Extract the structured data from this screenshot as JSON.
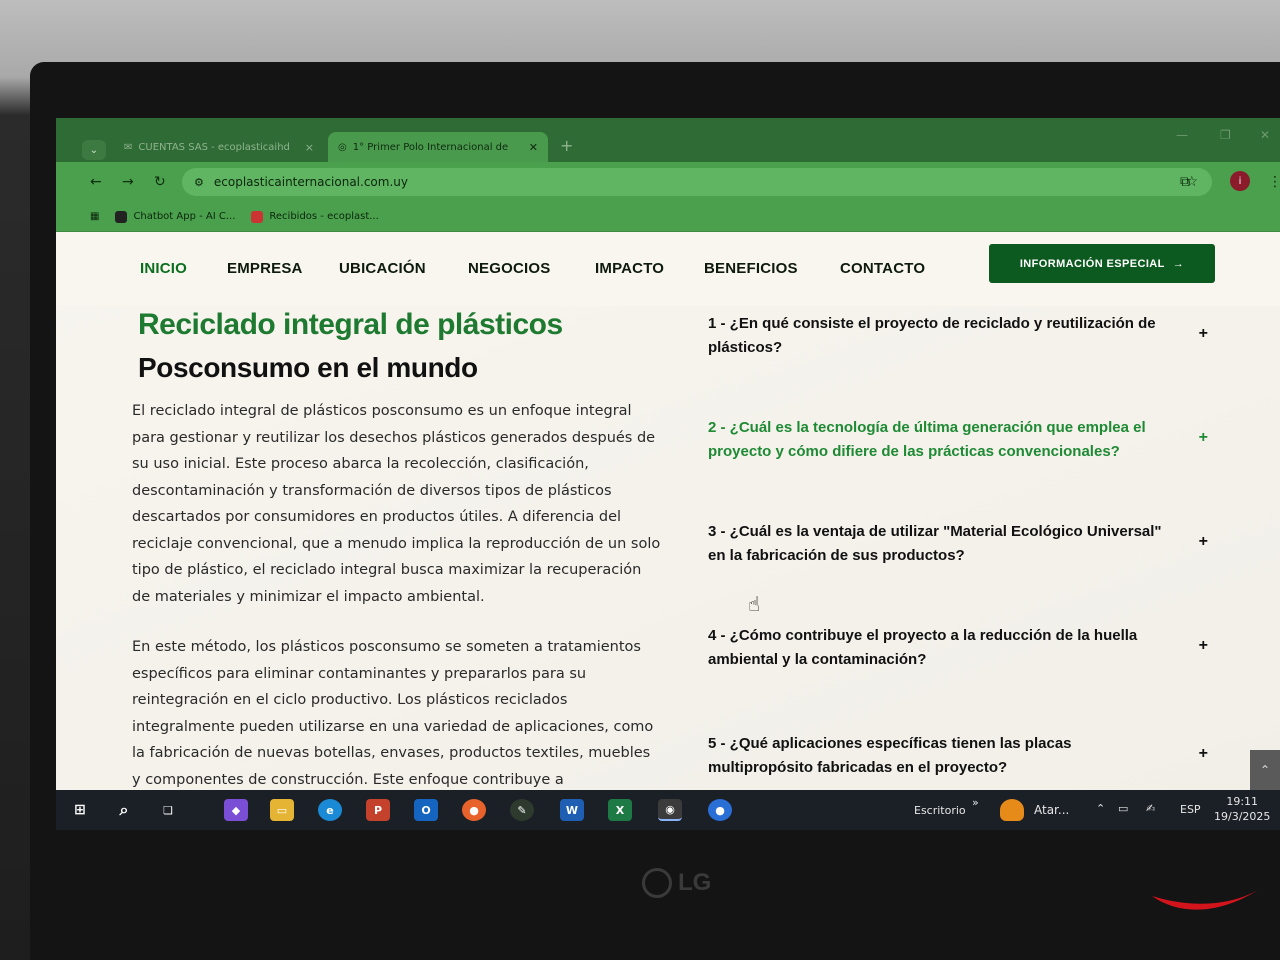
{
  "browser": {
    "tabs": [
      {
        "label": "CUENTAS SAS - ecoplasticaihd",
        "state": "inactive"
      },
      {
        "label": "1° Primer Polo Internacional de",
        "state": "active"
      }
    ],
    "new_tab": "+",
    "url": "ecoplasticainternacional.com.uy",
    "bookmarks": [
      {
        "label": "Chatbot App - AI C..."
      },
      {
        "label": "Recibidos - ecoplast..."
      }
    ]
  },
  "nav": {
    "items": [
      "INICIO",
      "EMPRESA",
      "UBICACIÓN",
      "NEGOCIOS",
      "IMPACTO",
      "BENEFICIOS",
      "CONTACTO"
    ],
    "active": "INICIO",
    "cta_label": "INFORMACIÓN ESPECIAL",
    "cta_arrow": "→"
  },
  "hero": {
    "title": "Reciclado integral de plásticos",
    "subtitle": "Posconsumo en el mundo",
    "paragraph1": "El reciclado integral de plásticos posconsumo es un enfoque integral para gestionar y reutilizar los desechos plásticos generados después de su uso inicial. Este proceso abarca la recolección, clasificación, descontaminación y transformación de diversos tipos de plásticos descartados por consumidores en productos útiles. A diferencia del reciclaje convencional, que a menudo implica la reproducción de un solo tipo de plástico, el reciclado integral busca maximizar la recuperación de materiales y minimizar el impacto ambiental.",
    "paragraph2": "En este método, los plásticos posconsumo se someten a tratamientos específicos para eliminar contaminantes y prepararlos para su reintegración en el ciclo productivo. Los plásticos reciclados integralmente pueden utilizarse en una variedad de aplicaciones, como la fabricación de nuevas botellas, envases, productos textiles, muebles y componentes de construcción. Este enfoque contribuye a"
  },
  "faq": [
    {
      "q": "1 - ¿En qué consiste el proyecto de reciclado y reutilización de plásticos?",
      "icon": "+",
      "highlighted": false
    },
    {
      "q": "2 - ¿Cuál es la tecnología de última generación que emplea el proyecto y cómo difiere de las prácticas convencionales?",
      "icon": "+",
      "highlighted": true
    },
    {
      "q": "3 - ¿Cuál es la ventaja de utilizar \"Material Ecológico Universal\" en la fabricación de sus productos?",
      "icon": "+",
      "highlighted": false
    },
    {
      "q": "4 - ¿Cómo contribuye el proyecto a la reducción de la huella ambiental y la contaminación?",
      "icon": "+",
      "highlighted": false
    },
    {
      "q": "5 - ¿Qué aplicaciones específicas tienen las placas multipropósito fabricadas en el proyecto?",
      "icon": "+",
      "highlighted": false
    }
  ],
  "taskbar": {
    "desktop_label": "Escritorio",
    "chevron": "»",
    "weather": "Atar...",
    "lang": "ESP",
    "time": "19:11",
    "date": "19/3/2025"
  },
  "monitor_brand": "LG",
  "colors": {
    "accent_green": "#1e7a31",
    "cta_green": "#0c5a1f",
    "browser_green": "#4aa04c"
  }
}
